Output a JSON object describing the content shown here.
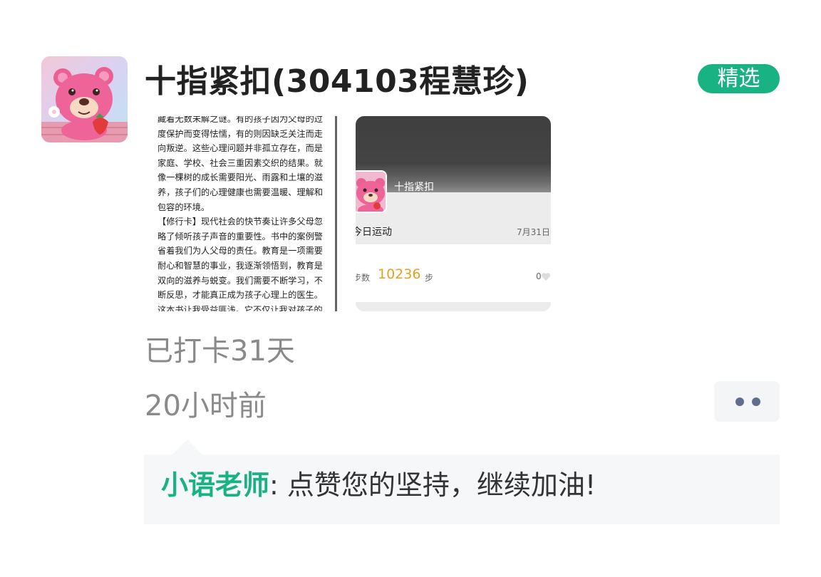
{
  "post": {
    "username": "十指紧扣(304103程慧珍)",
    "badge": "精选",
    "streak": "已打卡31天",
    "time_ago": "20小时前"
  },
  "images": {
    "document_text": [
      "藏着无数未解之谜。有的孩子因为父母的过度保护而变得怯懦，有的则因缺乏关注而走向叛逆。这些心理问题并非孤立存在，而是家庭、学校、社会三重因素交织的结果。就像一棵树的成长需要阳光、雨露和土壤的滋养，孩子们的心理健康也需要温暖、理解和包容的环境。",
      "【修行卡】现代社会的快节奏让许多父母忽略了倾听孩子声音的重要性。书中的案例警省着我们为人父母的责任。教育是一项需要耐心和智慧的事业，我逐渐领悟到，教育是双向的滋养与蜕变。我们需要不断学习，不断反思，才能真正成为孩子心理上的医生。这本书让我受益匪浅。它不仅让我对孩子的"
    ],
    "steps_card": {
      "user_name": "十指紧扣",
      "title": "今日运动",
      "date": "7月31日",
      "steps_label": "步数",
      "steps_value": "10236",
      "steps_unit": "步",
      "likes": "0"
    }
  },
  "comment": {
    "author": "小语老师",
    "separator": ":",
    "text": "点赞您的坚持，继续加油!"
  },
  "colors": {
    "accent": "#19b383",
    "steps_value": "#e3a122",
    "more_dots": "#5f6d8f"
  }
}
